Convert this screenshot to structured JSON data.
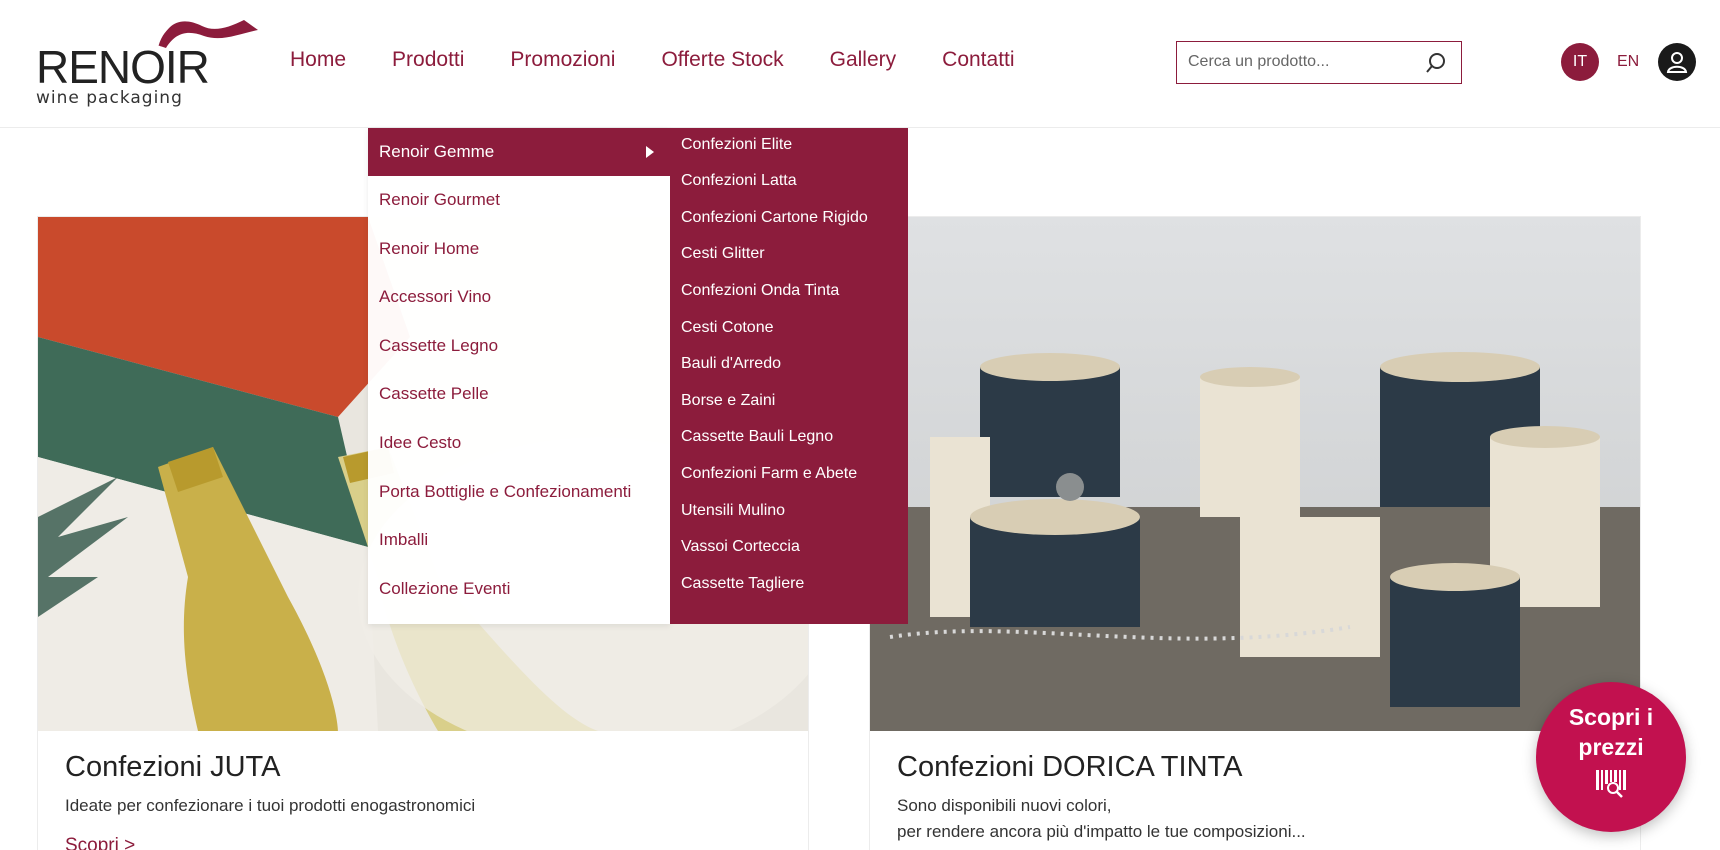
{
  "brand": {
    "name": "RENOIR",
    "tagline": "wine packaging"
  },
  "nav": {
    "items": [
      {
        "label": "Home"
      },
      {
        "label": "Prodotti"
      },
      {
        "label": "Promozioni"
      },
      {
        "label": "Offerte Stock"
      },
      {
        "label": "Gallery"
      },
      {
        "label": "Contatti"
      }
    ]
  },
  "search": {
    "placeholder": "Cerca un prodotto...",
    "icon": "search-icon"
  },
  "lang": {
    "it": "IT",
    "en": "EN",
    "active": "IT"
  },
  "user": {
    "icon": "user-icon"
  },
  "dropdown": {
    "items": [
      {
        "label": "Renoir Gemme",
        "active": true
      },
      {
        "label": "Renoir Gourmet"
      },
      {
        "label": "Renoir Home"
      },
      {
        "label": "Accessori Vino"
      },
      {
        "label": "Cassette Legno"
      },
      {
        "label": "Cassette Pelle"
      },
      {
        "label": "Idee Cesto"
      },
      {
        "label": "Porta Bottiglie e Confezionamenti"
      },
      {
        "label": "Imballi"
      },
      {
        "label": "Collezione Eventi"
      }
    ]
  },
  "submenu": {
    "items": [
      {
        "label": "Confezioni Elite"
      },
      {
        "label": "Confezioni Latta"
      },
      {
        "label": "Confezioni Cartone Rigido"
      },
      {
        "label": "Cesti Glitter"
      },
      {
        "label": "Confezioni Onda Tinta"
      },
      {
        "label": "Cesti Cotone"
      },
      {
        "label": "Bauli d'Arredo"
      },
      {
        "label": "Borse e Zaini"
      },
      {
        "label": "Cassette Bauli Legno"
      },
      {
        "label": "Confezioni Farm e Abete"
      },
      {
        "label": "Utensili Mulino"
      },
      {
        "label": "Vassoi Corteccia"
      },
      {
        "label": "Cassette Tagliere"
      }
    ]
  },
  "cards": [
    {
      "title": "Confezioni JUTA",
      "desc_line1": "Ideate per confezionare i tuoi prodotti enogastronomici",
      "link": "Scopri >"
    },
    {
      "title": "Confezioni DORICA TINTA",
      "desc_line1": "Sono disponibili nuovi colori,",
      "desc_line2": "per rendere ancora più d'impatto le tue composizioni..."
    }
  ],
  "cta": {
    "line1": "Scopri i",
    "line2": "prezzi",
    "icon": "barcode-search-icon"
  },
  "colors": {
    "brand": "#8c1c3c",
    "cta": "#c2114f"
  }
}
